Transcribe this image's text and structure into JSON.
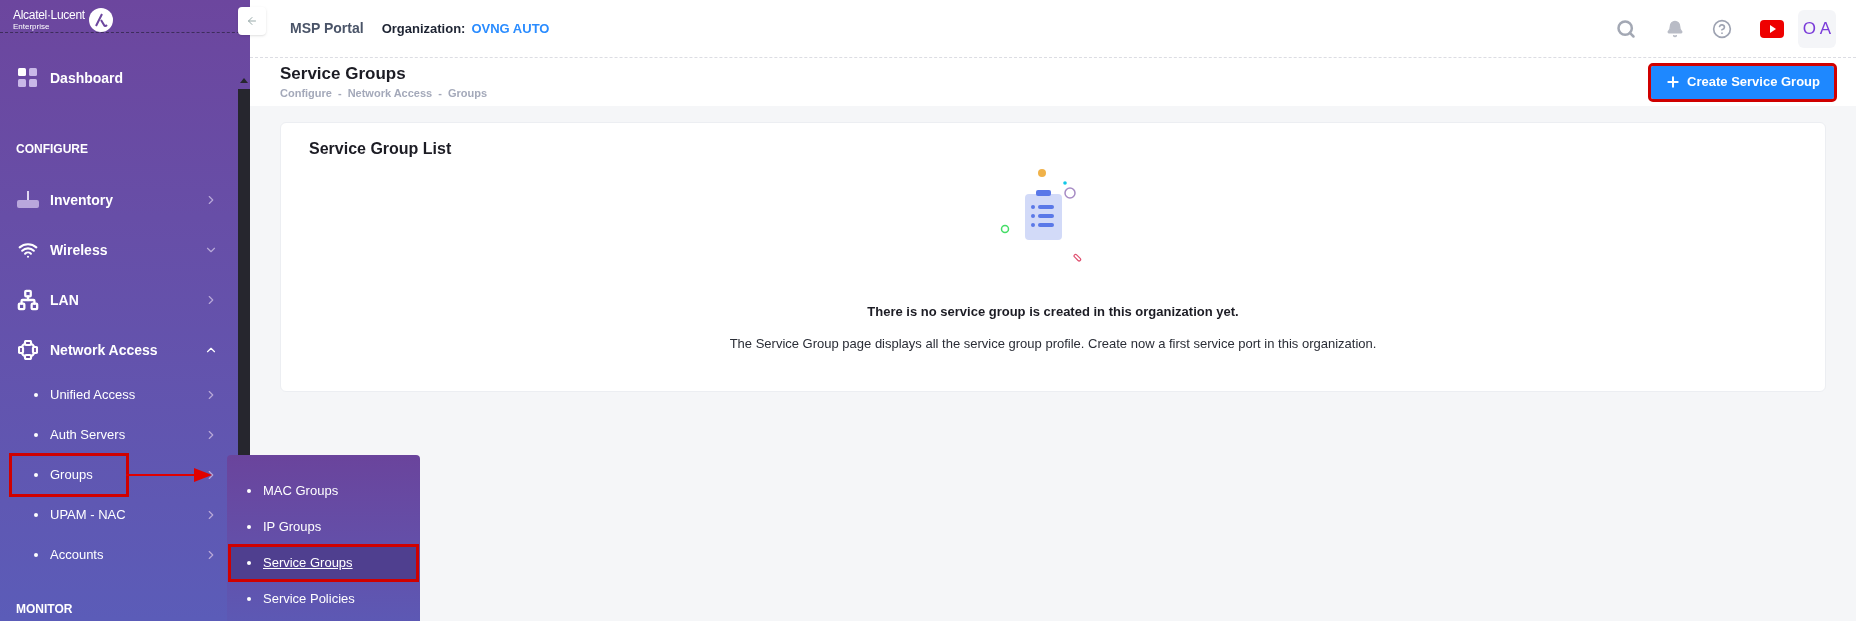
{
  "brand": {
    "name": "Alcatel·Lucent",
    "sub": "Enterprise"
  },
  "topbar": {
    "portal": "MSP Portal",
    "org_label": "Organization:",
    "org_value": "OVNG AUTO",
    "avatar": "O A"
  },
  "sidebar": {
    "items": [
      {
        "kind": "link",
        "label": "Dashboard"
      },
      {
        "kind": "section",
        "label": "CONFIGURE"
      },
      {
        "kind": "item",
        "label": "Inventory"
      },
      {
        "kind": "group",
        "label": "Wireless",
        "expanded": false
      },
      {
        "kind": "item",
        "label": "LAN"
      },
      {
        "kind": "group",
        "label": "Network Access",
        "expanded": true,
        "children": [
          {
            "label": "Unified Access",
            "highlighted": false
          },
          {
            "label": "Auth Servers",
            "highlighted": false
          },
          {
            "label": "Groups",
            "highlighted": true
          },
          {
            "label": "UPAM - NAC",
            "highlighted": false
          },
          {
            "label": "Accounts",
            "highlighted": false
          }
        ]
      },
      {
        "kind": "section",
        "label": "MONITOR"
      }
    ]
  },
  "submenu": {
    "items": [
      {
        "label": "MAC Groups",
        "selected": false,
        "highlighted": false
      },
      {
        "label": "IP Groups",
        "selected": false,
        "highlighted": false
      },
      {
        "label": "Service Groups",
        "selected": true,
        "highlighted": true
      },
      {
        "label": "Service Policies",
        "selected": false,
        "highlighted": false
      }
    ]
  },
  "page": {
    "title": "Service Groups",
    "breadcrumb": [
      "Configure",
      "Network Access",
      "Groups"
    ],
    "breadcrumb_sep": "-",
    "create_button": {
      "label": "Create Service Group",
      "highlighted": true
    }
  },
  "card": {
    "title": "Service Group List",
    "empty_title": "There is no service group is created in this organization yet.",
    "empty_text": "The Service Group page displays all the service group profile. Create now a first service port in this organization."
  }
}
